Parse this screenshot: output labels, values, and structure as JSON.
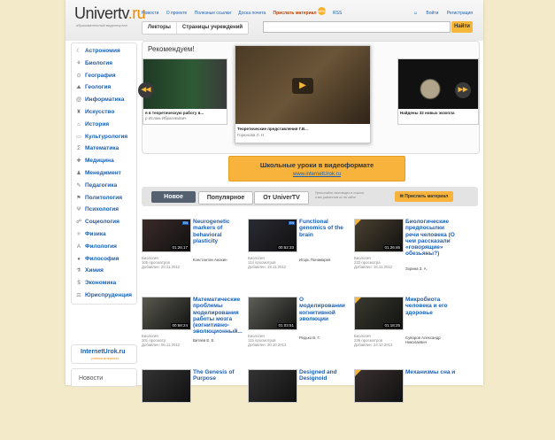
{
  "header": {
    "logo_main": "Univertv",
    "logo_ru": ".ru",
    "logo_sub": "образовательный видеопортал",
    "nav": [
      "Новости",
      "О проекте",
      "Полезные ссылки",
      "Доска почета"
    ],
    "nav_send": "Прислать материал",
    "nav_badge": "NEW",
    "nav_rss": "RSS",
    "login": "Войти",
    "register": "Регистрация",
    "subtab_lecturers": "Лекторы",
    "subtab_institutions": "Страницы учреждений",
    "search_placeholder": "",
    "find_button": "Найти"
  },
  "sidebar": {
    "categories": [
      {
        "label": "Астрономия",
        "icon": "☾"
      },
      {
        "label": "Биология",
        "icon": "⚘"
      },
      {
        "label": "География",
        "icon": "⊙"
      },
      {
        "label": "Геология",
        "icon": "⛰"
      },
      {
        "label": "Информатика",
        "icon": "@"
      },
      {
        "label": "Искусство",
        "icon": "♜"
      },
      {
        "label": "История",
        "icon": "⌂"
      },
      {
        "label": "Культурология",
        "icon": "▭"
      },
      {
        "label": "Математика",
        "icon": "Σ"
      },
      {
        "label": "Медицина",
        "icon": "✚"
      },
      {
        "label": "Менеджмент",
        "icon": "♟"
      },
      {
        "label": "Педагогика",
        "icon": "✎"
      },
      {
        "label": "Политология",
        "icon": "⚑"
      },
      {
        "label": "Психология",
        "icon": "Ψ"
      },
      {
        "label": "Социология",
        "icon": "☍"
      },
      {
        "label": "Физика",
        "icon": "⚛"
      },
      {
        "label": "Филология",
        "icon": "A"
      },
      {
        "label": "Философия",
        "icon": "●"
      },
      {
        "label": "Химия",
        "icon": "⚗"
      },
      {
        "label": "Экономика",
        "icon": "$"
      },
      {
        "label": "Юриспруденция",
        "icon": "⚖"
      }
    ],
    "iu_title": "InternetUrok.ru",
    "iu_sub": "учиться интересно!",
    "news": "Новости"
  },
  "recommend": {
    "title": "Рекомендуем!",
    "left_caption": "я в теоретическую работу в...",
    "left_author": "р Ислам Ибрагимович",
    "center_caption": "Теоретические представления Г.В...",
    "center_author": "Горюнова Л. Н.",
    "right_caption": "Найдены 32 новых экзопла"
  },
  "school": {
    "title": "Школьные уроки в видеоформате",
    "link": "www.internetUrok.ru"
  },
  "videos": {
    "tab_new": "Новое",
    "tab_popular": "Популярное",
    "tab_univer": "От UniverTV",
    "promo_line1": "Присылайте свои видео и ссылки,",
    "promo_line2": "а мы разместим их на сайте",
    "send_button": "Прислать материал",
    "cards": [
      {
        "title": "Neurogenetic markers of behavioral plasticity",
        "duration": "01:26:17",
        "lang": "EN",
        "category": "Биология",
        "views": "105 просмотров",
        "added": "Добавлен: 20.11.2012",
        "author": "Константин Анохин",
        "marked": false
      },
      {
        "title": "Functional genomics of the brain",
        "duration": "00:52:33",
        "lang": "EN",
        "category": "Биология",
        "views": "114 просмотров",
        "added": "Добавлен: 19.11.2012",
        "author": "Игорь Понамарев",
        "marked": false
      },
      {
        "title": "Биологические предпосылки речи человека (О чем рассказали «говорящие» обезьяны?)",
        "duration": "01:26:46",
        "lang": "",
        "category": "Биология",
        "views": "233 просмотра",
        "added": "Добавлен: 16.11.2012",
        "author": "Зорина З. А.",
        "marked": true
      },
      {
        "title": "Математические проблемы моделирования работы мозга (когнитивно-эволюционный...",
        "duration": "00:58:24",
        "lang": "",
        "category": "Биология",
        "views": "201 просмотр",
        "added": "Добавлен: 06.11.2012",
        "author": "Витяев Е. Е.",
        "marked": false
      },
      {
        "title": "О моделировании когнитивной эволюции",
        "duration": "01:03:51",
        "lang": "",
        "category": "Биология",
        "views": "115 просмотров",
        "added": "Добавлен: 30.10.2012",
        "author": "Редько В. Г.",
        "marked": false
      },
      {
        "title": "Микробиота человека и его здоровье",
        "duration": "01:18:25",
        "lang": "",
        "category": "Биология",
        "views": "236 просмотров",
        "added": "Добавлен: 24.10.2012",
        "author": "Суворов Александр Николаевич",
        "marked": true
      },
      {
        "title": "The Genesis of Purpose",
        "duration": "",
        "lang": "",
        "category": "",
        "views": "",
        "added": "",
        "author": "",
        "marked": false
      },
      {
        "title": "Designed and Designoid",
        "duration": "",
        "lang": "",
        "category": "",
        "views": "",
        "added": "",
        "author": "",
        "marked": false
      },
      {
        "title": "Механизмы сна и",
        "duration": "",
        "lang": "",
        "category": "",
        "views": "",
        "added": "",
        "author": "",
        "marked": true
      }
    ]
  },
  "colors": {
    "accent": "#f5b73a",
    "link": "#1a5fb4",
    "background": "#f3eac9"
  }
}
